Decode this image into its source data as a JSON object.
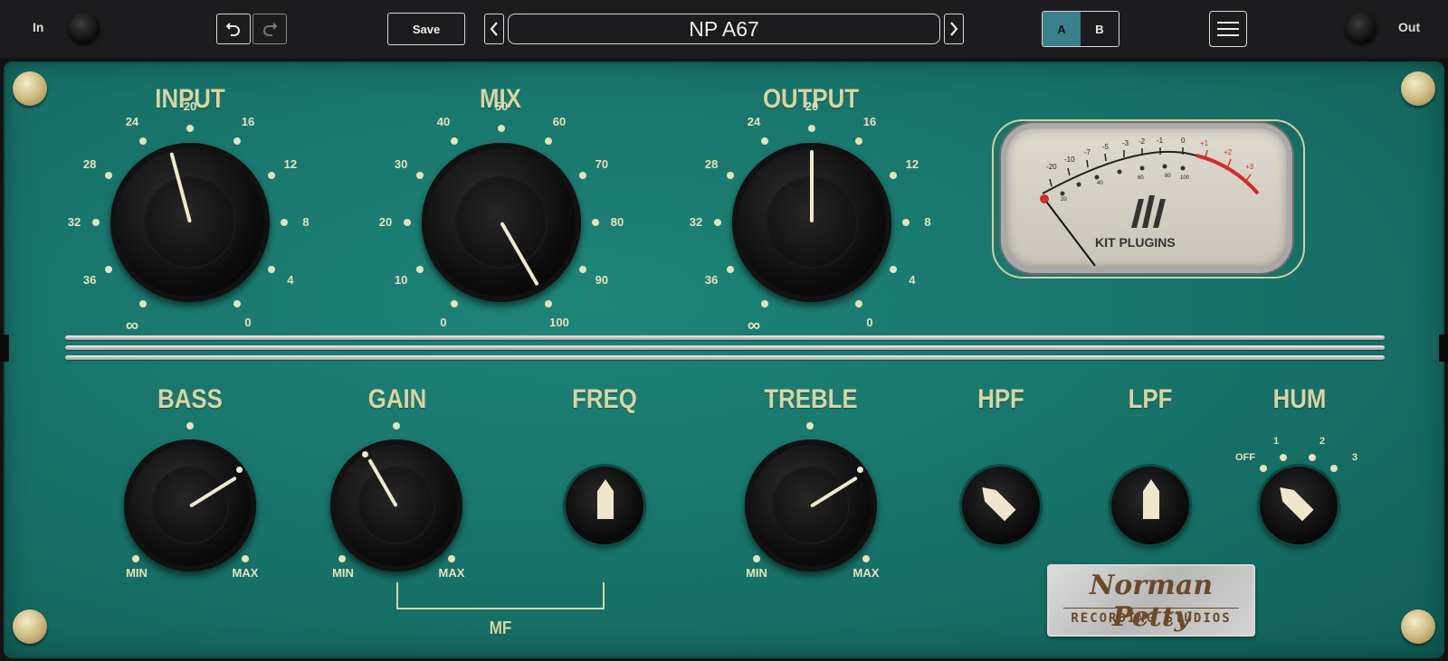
{
  "topbar": {
    "in_label": "In",
    "out_label": "Out",
    "undo_icon": "undo-icon",
    "redo_icon": "redo-icon",
    "save_label": "Save",
    "preset_name": "NP A67",
    "prev_icon": "chevron-left-icon",
    "next_icon": "chevron-right-icon",
    "ab_a": "A",
    "ab_b": "B",
    "ab_active": "A",
    "menu_icon": "hamburger-menu-icon"
  },
  "colors": {
    "panel": "#177268",
    "label": "#d8d4a4",
    "ab_active": "#3a7f8c",
    "meter_red": "#d42a2a"
  },
  "top_section": {
    "input": {
      "label": "INPUT",
      "scale": [
        "∞",
        "36",
        "32",
        "28",
        "24",
        "20",
        "16",
        "12",
        "8",
        "4",
        "0"
      ],
      "value": "22"
    },
    "mix": {
      "label": "MIX",
      "scale": [
        "0",
        "10",
        "20",
        "30",
        "40",
        "50",
        "60",
        "70",
        "80",
        "90",
        "100"
      ],
      "value": "100"
    },
    "output": {
      "label": "OUTPUT",
      "scale": [
        "∞",
        "36",
        "32",
        "28",
        "24",
        "20",
        "16",
        "12",
        "8",
        "4",
        "0"
      ],
      "value": "20"
    }
  },
  "meter": {
    "scale": [
      "-20",
      "-10",
      "-7",
      "-5",
      "-3",
      "-2",
      "-1",
      "0",
      "+1",
      "+2",
      "+3"
    ],
    "percent_scale": [
      "20",
      "40",
      "60",
      "80",
      "100"
    ],
    "brand": "KIT PLUGINS",
    "logo_icon": "kit-plugins-logo-icon"
  },
  "bottom_section": {
    "bass": {
      "label": "BASS",
      "min": "MIN",
      "max": "MAX"
    },
    "gain": {
      "label": "GAIN",
      "min": "MIN",
      "max": "MAX"
    },
    "freq": {
      "label": "FREQ"
    },
    "treble": {
      "label": "TREBLE",
      "min": "MIN",
      "max": "MAX"
    },
    "hpf": {
      "label": "HPF"
    },
    "lpf": {
      "label": "LPF"
    },
    "hum": {
      "label": "HUM",
      "positions": [
        "OFF",
        "1",
        "2",
        "3"
      ]
    },
    "mf_label": "MF"
  },
  "badge": {
    "line1": "Norman Petty",
    "line2": "RECORDING STUDIOS"
  }
}
